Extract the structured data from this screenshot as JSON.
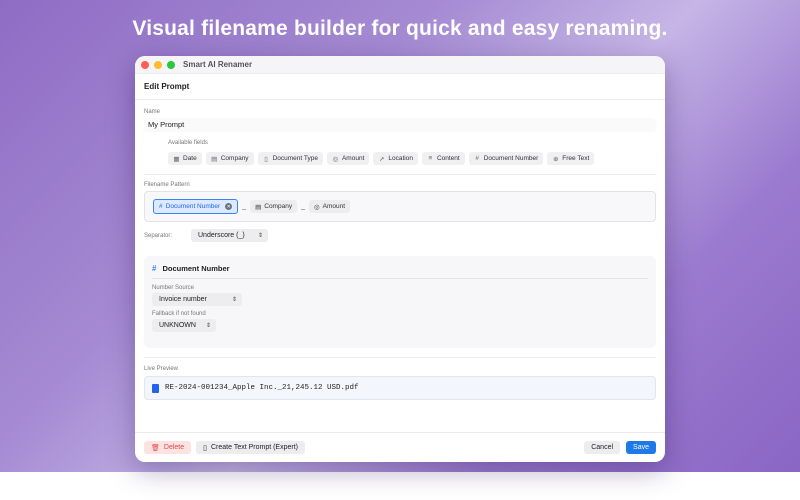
{
  "headline": "Visual filename builder for quick and easy renaming.",
  "window": {
    "title": "Smart AI Renamer",
    "page_title": "Edit Prompt"
  },
  "name": {
    "label": "Name",
    "value": "My Prompt"
  },
  "available_fields": {
    "label": "Available fields",
    "items": [
      {
        "icon": "calendar-icon",
        "glyph": "▦",
        "label": "Date"
      },
      {
        "icon": "building-icon",
        "glyph": "▤",
        "label": "Company"
      },
      {
        "icon": "document-icon",
        "glyph": "▯",
        "label": "Document Type"
      },
      {
        "icon": "currency-icon",
        "glyph": "◎",
        "label": "Amount"
      },
      {
        "icon": "location-arrow-icon",
        "glyph": "➚",
        "label": "Location"
      },
      {
        "icon": "text-lines-icon",
        "glyph": "≡",
        "label": "Content"
      },
      {
        "icon": "hash-icon",
        "glyph": "#",
        "label": "Document Number"
      },
      {
        "icon": "plus-circle-icon",
        "glyph": "⊕",
        "label": "Free Text"
      }
    ]
  },
  "pattern": {
    "label": "Filename Pattern",
    "tokens": [
      {
        "icon": "hash-icon",
        "glyph": "#",
        "label": "Document Number",
        "selected": true
      },
      {
        "icon": "building-icon",
        "glyph": "▤",
        "label": "Company",
        "selected": false
      },
      {
        "icon": "currency-icon",
        "glyph": "◎",
        "label": "Amount",
        "selected": false
      }
    ],
    "separator_glyph": "_",
    "remove_glyph": "✕"
  },
  "separator": {
    "label": "Separator:",
    "value": "Underscore (_)"
  },
  "detail": {
    "title": "Document Number",
    "hash_glyph": "#",
    "source_label": "Number Source",
    "source_value": "Invoice number",
    "fallback_label": "Fallback if not found",
    "fallback_value": "UNKNOWN"
  },
  "preview": {
    "label": "Live Preview",
    "value": "RE-2024-001234_Apple Inc._21,245.12 USD.pdf"
  },
  "footer": {
    "delete_label": "Delete",
    "expert_label": "Create Text Prompt (Expert)",
    "cancel_label": "Cancel",
    "save_label": "Save"
  },
  "colors": {
    "accent": "#1f7ae8",
    "selected_border": "#3b82f6",
    "delete": "#e04848"
  }
}
